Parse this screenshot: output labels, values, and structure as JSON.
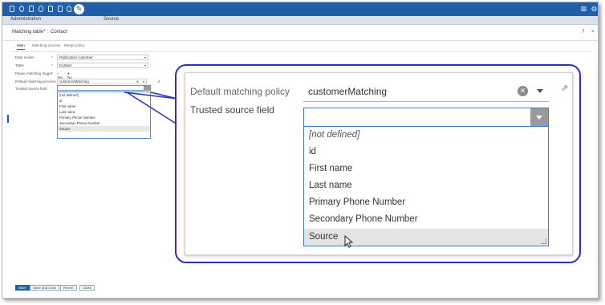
{
  "app": {
    "section": "Administration",
    "center_title": "Source"
  },
  "record": {
    "table_label": "Matching table*",
    "separator": ":",
    "name": "Contact",
    "help": "?",
    "close": "×"
  },
  "tabs": [
    {
      "label": "Main",
      "active": true
    },
    {
      "label": "Matching process",
      "active": false
    },
    {
      "label": "Merge policy",
      "active": false
    }
  ],
  "form": {
    "data_model_label": "Data model",
    "data_model_value": "Publication customer",
    "table_label": "Table",
    "table_value": "Contact",
    "pause_label": "Pause matching trigger",
    "pause_yes": "Yes",
    "pause_no": "No",
    "policy_label": "Default matching process",
    "policy_value": "customerMatching",
    "trusted_label": "Trusted source field",
    "required_mark": "*"
  },
  "small_dropdown": {
    "options": [
      "[not defined]",
      "id",
      "First name",
      "Last name",
      "Primary Phone Number",
      "Secondary Phone Number",
      "Source"
    ],
    "highlighted": "Source"
  },
  "zoom": {
    "policy_label": "Default matching policy",
    "policy_value": "customerMatching",
    "trusted_label": "Trusted source field",
    "trusted_value": "",
    "options": [
      "[not defined]",
      "id",
      "First name",
      "Last name",
      "Primary Phone Number",
      "Secondary Phone Number",
      "Source"
    ],
    "highlighted": "Source"
  },
  "footer": {
    "save": "Save",
    "save_close": "Save and close",
    "revert": "Revert",
    "close": "Close"
  },
  "colors": {
    "brand": "#1f5fa8",
    "callout": "#2c2fc2",
    "focus": "#3b7be0"
  }
}
